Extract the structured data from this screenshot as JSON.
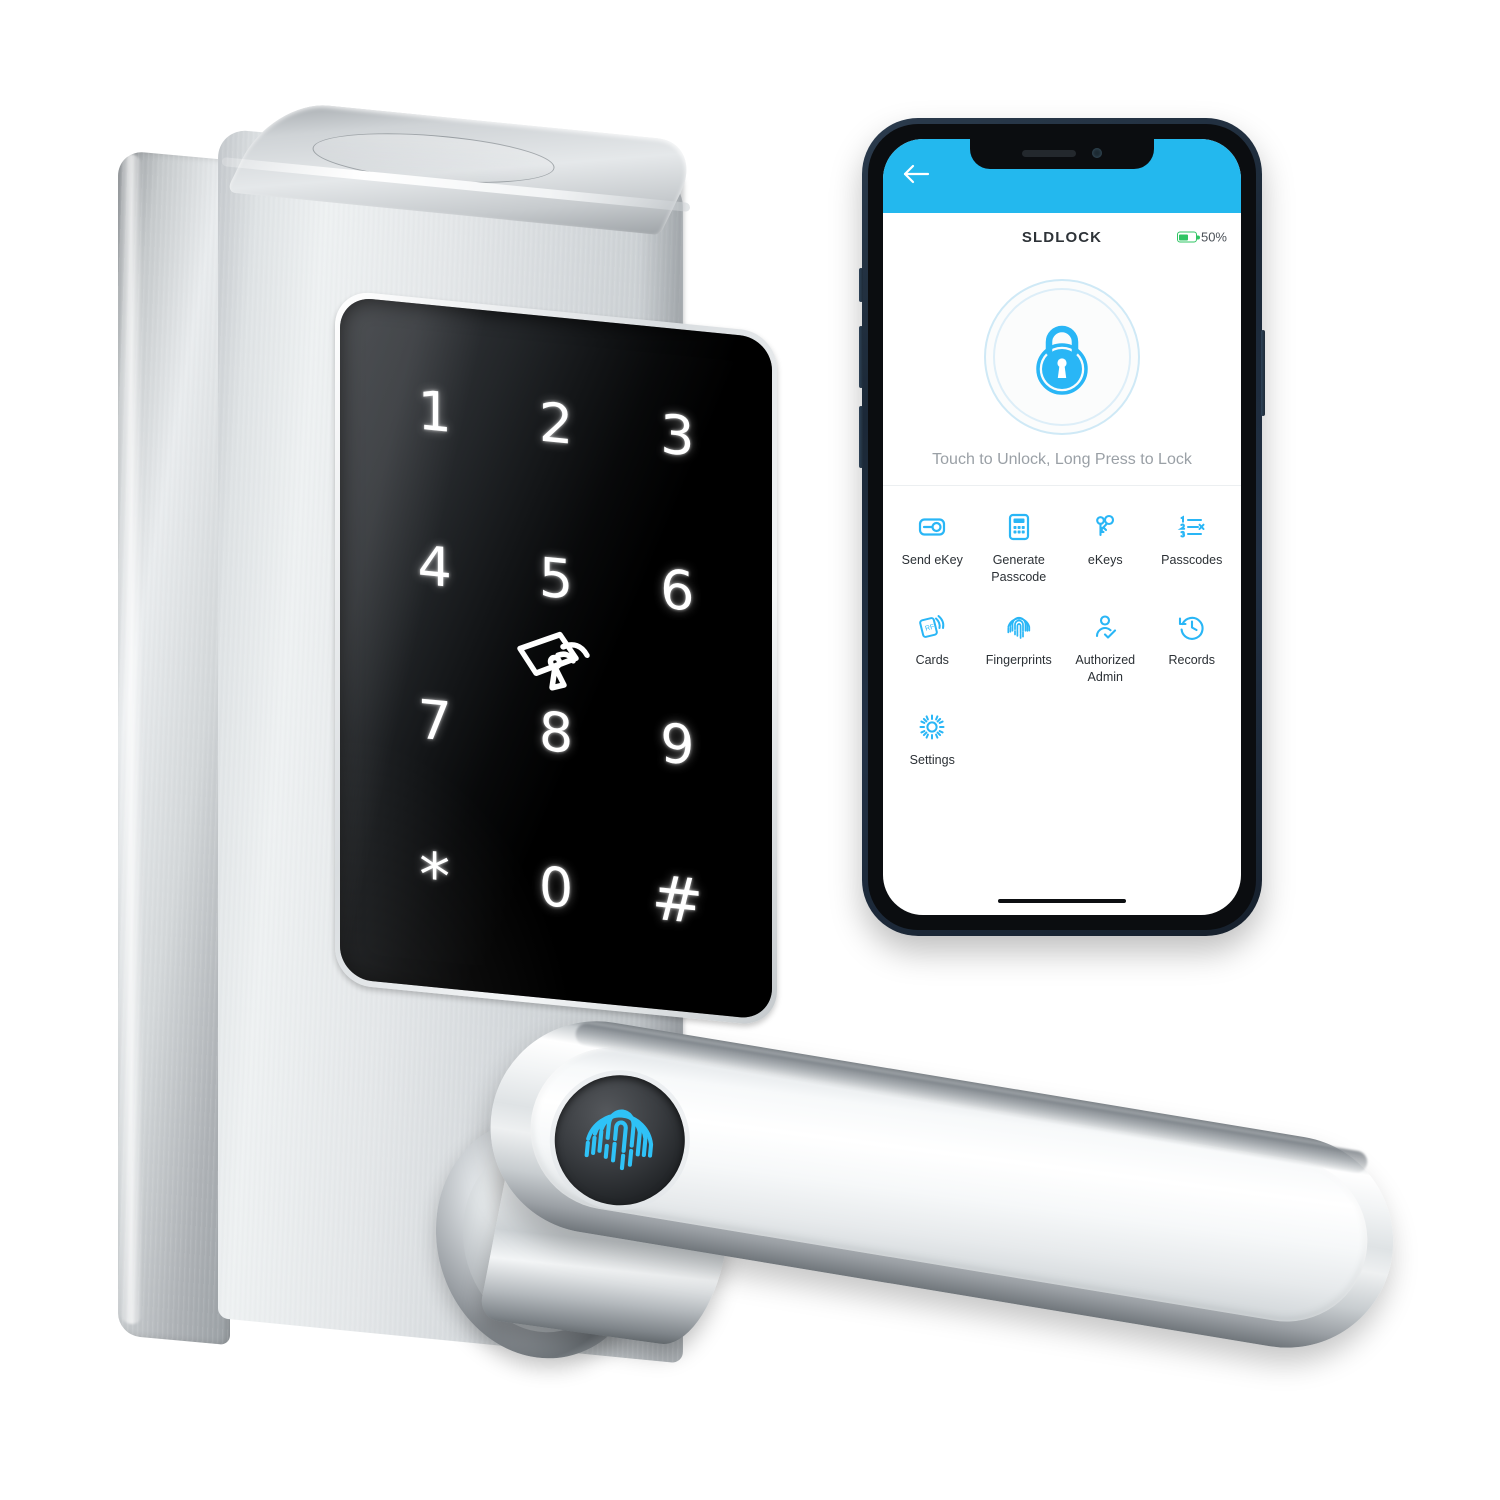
{
  "product": {
    "name": "smart-door-lock",
    "keypad": {
      "keys": [
        "1",
        "2",
        "3",
        "4",
        "5",
        "6",
        "7",
        "8",
        "9",
        "*",
        "0",
        "#"
      ],
      "center_icon": "rfid-card-icon"
    },
    "handle": {
      "fingerprint_sensor_icon": "fingerprint-icon",
      "fingerprint_color": "#29b6f6"
    },
    "colors": {
      "body": "#d8dcdf",
      "glass": "#000000",
      "key_text": "#ffffff"
    }
  },
  "phone": {
    "header": {
      "back_icon": "back-arrow-icon",
      "bar_color": "#23b8ee"
    },
    "titlebar": {
      "title": "SLDLOCK",
      "battery_icon": "battery-icon",
      "battery_label": "50%",
      "battery_percent": 50,
      "battery_color": "#2fc463"
    },
    "lock_button": {
      "icon": "padlock-icon",
      "accent": "#29b6f6"
    },
    "hint": "Touch to Unlock, Long Press to Lock",
    "grid": [
      {
        "icon": "send-ekey-icon",
        "label": "Send eKey"
      },
      {
        "icon": "calculator-icon",
        "label": "Generate Passcode"
      },
      {
        "icon": "keys-icon",
        "label": "eKeys"
      },
      {
        "icon": "numbered-list-icon",
        "label": "Passcodes"
      },
      {
        "icon": "rfid-card-icon",
        "label": "Cards"
      },
      {
        "icon": "fingerprint-icon",
        "label": "Fingerprints"
      },
      {
        "icon": "person-check-icon",
        "label": "Authorized Admin"
      },
      {
        "icon": "clock-history-icon",
        "label": "Records"
      },
      {
        "icon": "gear-icon",
        "label": "Settings"
      }
    ]
  }
}
